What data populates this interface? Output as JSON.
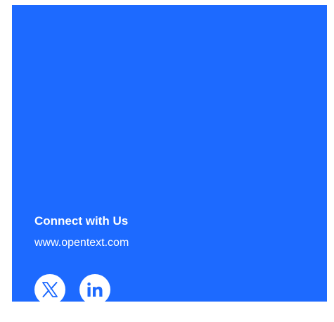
{
  "footer": {
    "connect_title": "Connect with Us",
    "website_link": "www.opentext.com",
    "social": [
      {
        "name": "x",
        "icon": "x-logo-icon"
      },
      {
        "name": "linkedin",
        "icon": "linkedin-icon"
      }
    ]
  },
  "colors": {
    "panel_background": "#1d6aff",
    "text": "#ffffff",
    "icon_background": "#ffffff",
    "icon_glyph": "#1d6aff"
  }
}
